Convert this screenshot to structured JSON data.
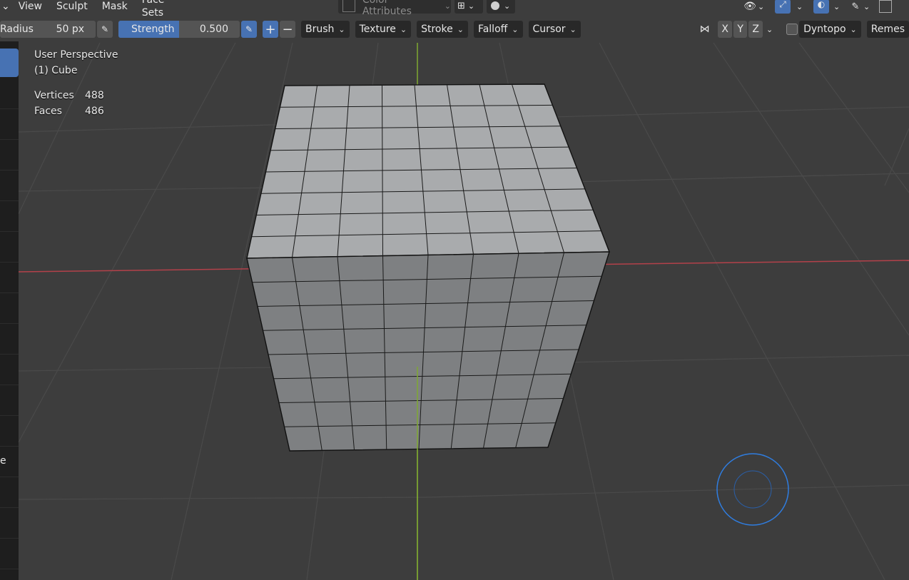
{
  "menu": {
    "items": [
      "View",
      "Sculpt",
      "Mask",
      "Face Sets"
    ]
  },
  "header_center": {
    "color_attributes": "Color Attributes"
  },
  "toolbar": {
    "radius_label": "Radius",
    "radius_value": "50 px",
    "strength_label": "Strength",
    "strength_value": "0.500",
    "brush": "Brush",
    "texture": "Texture",
    "stroke": "Stroke",
    "falloff": "Falloff",
    "cursor": "Cursor",
    "axis_x": "X",
    "axis_y": "Y",
    "axis_z": "Z",
    "dyntopo": "Dyntopo",
    "remesh": "Remes"
  },
  "overlay": {
    "view_name": "User Perspective",
    "object_name": "(1) Cube",
    "vertices_label": "Vertices",
    "vertices_value": "488",
    "faces_label": "Faces",
    "faces_value": "486"
  },
  "left_panel": {
    "cut_label": "e"
  },
  "colors": {
    "background": "#3d3d3d",
    "accent": "#4772b3",
    "x_axis": "#c0404a",
    "y_axis": "#8cb83a",
    "brush_cursor": "#2f7de0",
    "mesh_face": "#a5a7a9"
  },
  "icons": [
    "visibility-eye-icon",
    "gizmo-icon",
    "overlay-icon",
    "shading-icon",
    "symmetry-icon",
    "add-icon",
    "subtract-icon",
    "pressure-icon"
  ]
}
